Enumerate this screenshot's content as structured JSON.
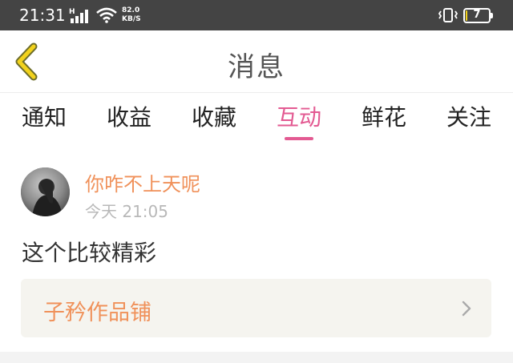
{
  "status_bar": {
    "time": "21:31",
    "network_type": "H",
    "net_speed_value": "82.0",
    "net_speed_unit": "KB/S",
    "battery_level": "7",
    "battery_fraction": 0.07,
    "signal_icon": "signal-bars-icon",
    "wifi_icon": "wifi-icon",
    "vibrate_icon": "vibrate-icon"
  },
  "header": {
    "title": "消息",
    "back_icon": "chevron-left-icon",
    "back_color": "#f2d21c"
  },
  "tabs": [
    {
      "label": "通知",
      "active": false
    },
    {
      "label": "收益",
      "active": false
    },
    {
      "label": "收藏",
      "active": false
    },
    {
      "label": "互动",
      "active": true
    },
    {
      "label": "鲜花",
      "active": false
    },
    {
      "label": "关注",
      "active": false
    }
  ],
  "message": {
    "username": "你咋不上天呢",
    "time": "今天 21:05",
    "content": "这个比较精彩",
    "reference": {
      "title": "子矜作品铺",
      "icon": "chevron-right-icon"
    }
  },
  "colors": {
    "accent": "#e35a92",
    "username": "#f0915a",
    "status_bar_bg": "#444444"
  }
}
